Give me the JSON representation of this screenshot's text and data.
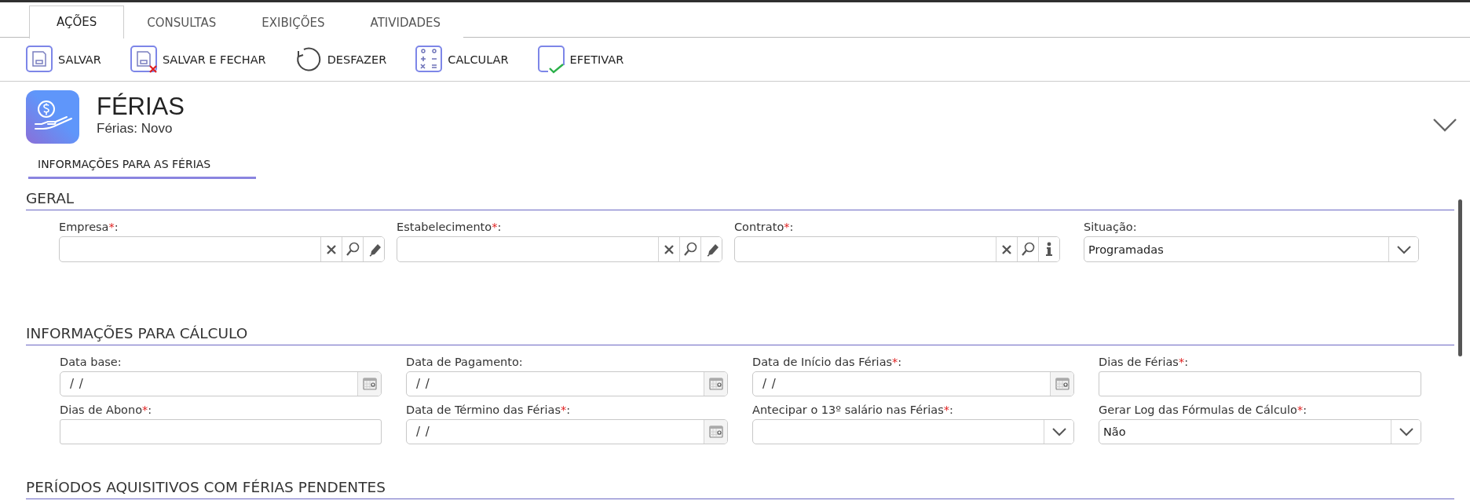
{
  "tabs": [
    {
      "label": "AÇÕES",
      "selected": true
    },
    {
      "label": "CONSULTAS",
      "selected": false
    },
    {
      "label": "EXIBIÇÕES",
      "selected": false
    },
    {
      "label": "ATIVIDADES",
      "selected": false
    }
  ],
  "toolbar": [
    {
      "kind": "save",
      "label": "SALVAR"
    },
    {
      "kind": "save_close",
      "label": "SALVAR E FECHAR"
    },
    {
      "kind": "undo",
      "label": "DESFAZER"
    },
    {
      "kind": "calculate",
      "label": "CALCULAR"
    },
    {
      "kind": "confirm",
      "label": "EFETIVAR"
    }
  ],
  "header": {
    "title": "FÉRIAS",
    "subtitle": "Férias: Novo"
  },
  "section_tabs": [
    {
      "label": "INFORMAÇÕES PARA AS FÉRIAS",
      "selected": true
    }
  ],
  "required_mark": "*",
  "label_separator": ":",
  "sections": [
    {
      "title": "GERAL",
      "fields": [
        {
          "kind": "lookup",
          "label": "Empresa",
          "required": true,
          "actions": [
            {
              "kind": "clear"
            },
            {
              "kind": "search"
            },
            {
              "kind": "edit"
            }
          ]
        },
        {
          "kind": "lookup",
          "label": "Estabelecimento",
          "required": true,
          "actions": [
            {
              "kind": "clear"
            },
            {
              "kind": "search"
            },
            {
              "kind": "edit"
            }
          ]
        },
        {
          "kind": "lookup",
          "label": "Contrato",
          "required": true,
          "actions": [
            {
              "kind": "clear"
            },
            {
              "kind": "search"
            },
            {
              "kind": "info"
            }
          ]
        },
        {
          "kind": "select",
          "label": "Situação",
          "required": false,
          "value": "Programadas"
        }
      ]
    },
    {
      "title": "INFORMAÇÕES PARA CÁLCULO",
      "fields": [
        {
          "kind": "date",
          "label": "Data base",
          "required": false,
          "value": "/ /"
        },
        {
          "kind": "date",
          "label": "Data de Pagamento",
          "required": false,
          "value": "/ /"
        },
        {
          "kind": "date",
          "label": "Data de Início das Férias",
          "required": true,
          "value": "/ /"
        },
        {
          "kind": "text",
          "label": "Dias de Férias",
          "required": true
        },
        {
          "kind": "text",
          "label": "Dias de Abono",
          "required": true
        },
        {
          "kind": "date",
          "label": "Data de Término das Férias",
          "required": true,
          "value": "/ /"
        },
        {
          "kind": "select",
          "label": "Antecipar o 13º salário nas Férias",
          "required": true
        },
        {
          "kind": "select",
          "label": "Gerar Log das Fórmulas de Cálculo",
          "required": true,
          "value": "Não"
        }
      ]
    },
    {
      "title": "PERÍODOS AQUISITIVOS COM FÉRIAS PENDENTES"
    }
  ]
}
